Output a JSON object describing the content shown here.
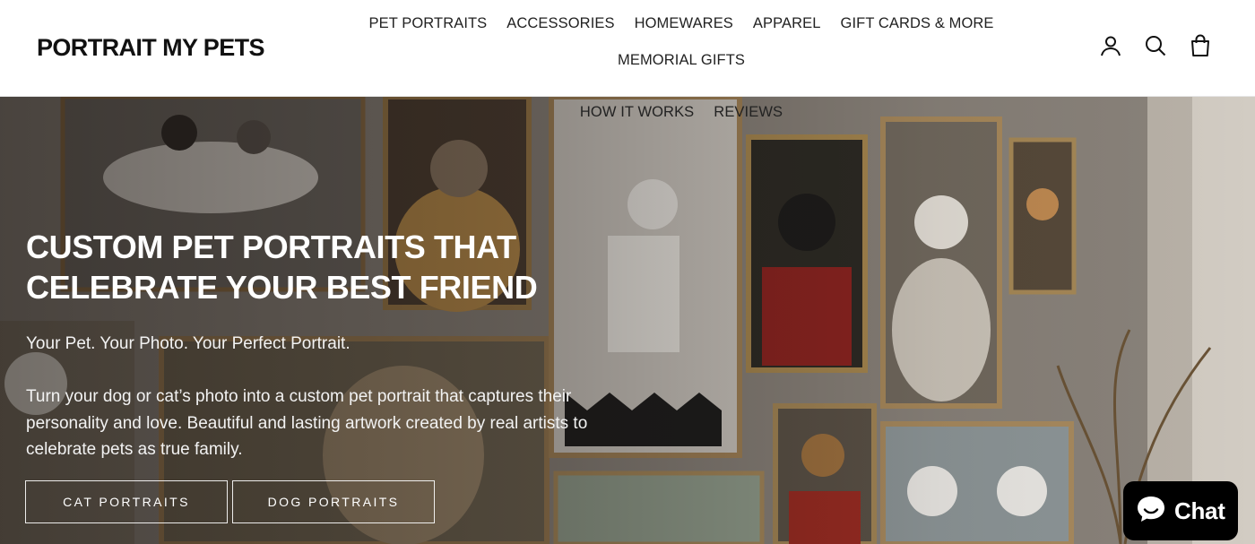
{
  "brand": {
    "logo_text": "PORTRAIT MY PETS"
  },
  "nav": {
    "items": [
      {
        "label": "PET PORTRAITS"
      },
      {
        "label": "ACCESSORIES"
      },
      {
        "label": "HOMEWARES"
      },
      {
        "label": "APPAREL"
      },
      {
        "label": "GIFT CARDS & MORE"
      },
      {
        "label": "MEMORIAL GIFTS"
      },
      {
        "label": "HOW IT WORKS"
      },
      {
        "label": "REVIEWS"
      }
    ]
  },
  "header_icons": [
    "account-icon",
    "search-icon",
    "bag-icon"
  ],
  "hero": {
    "title_line1": "CUSTOM PET PORTRAITS THAT",
    "title_line2": "CELEBRATE YOUR BEST FRIEND",
    "subtitle": "Your Pet. Your Photo. Your Perfect Portrait.",
    "description": "Turn your dog or cat’s photo into a custom pet portrait that captures their personality and love. Beautiful and lasting artwork created by real artists to celebrate pets as true family.",
    "buttons": [
      {
        "label": "CAT PORTRAITS"
      },
      {
        "label": "DOG PORTRAITS"
      }
    ]
  },
  "chat": {
    "label": "Chat",
    "icon": "chat-bubble-icon"
  },
  "colors": {
    "header_bg": "#ffffff",
    "text_dark": "#111111",
    "hero_text": "#ffffff",
    "chat_bg": "#000000"
  }
}
